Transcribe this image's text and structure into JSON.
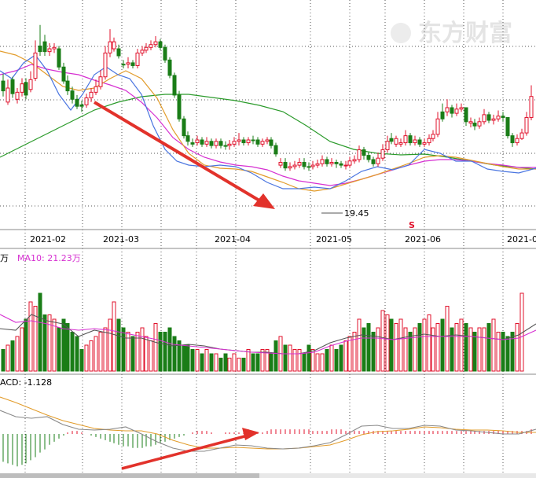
{
  "watermark": "东方财富",
  "price_panel": {
    "low_label": "19.45",
    "event_marker": "S",
    "ylim": [
      18.3,
      34.0
    ]
  },
  "x_axis": {
    "ticks": [
      "2021-02",
      "2021-03",
      "2021-04",
      "2021-05",
      "2021-06",
      "2021-0"
    ]
  },
  "volume_panel": {
    "legend_unit": "万",
    "legend_ma10": "MA10: 21.23万",
    "ylim": [
      0,
      24
    ]
  },
  "macd_panel": {
    "legend": "ACD: -1.128",
    "ylim": [
      -3.4,
      2.4
    ]
  },
  "colors": {
    "up": "#e0112b",
    "down": "#1a7d17",
    "ma5": "#4a75e0",
    "ma10": "#e29c2b",
    "ma20": "#d62fd1",
    "ma60": "#2a9a2a",
    "vol_ma5": "#555555",
    "vol_ma10": "#d62fd1",
    "dif": "#888888",
    "dea": "#e29c2b",
    "annotation_arrow": "#e2322b",
    "grid": "#555555"
  },
  "chart_data": {
    "type": "candlestick",
    "up": [
      0,
      1,
      0,
      1,
      1,
      0,
      1,
      1,
      0,
      0,
      1,
      1,
      0,
      0,
      0,
      0,
      0,
      0,
      1,
      1,
      1,
      1,
      1,
      1,
      1,
      0,
      0,
      1,
      0,
      1,
      1,
      1,
      1,
      1,
      0,
      0,
      0,
      0,
      0,
      0,
      0,
      0,
      1,
      0,
      1,
      0,
      1,
      0,
      0,
      1,
      1,
      1,
      0,
      1,
      0,
      0,
      1,
      1,
      0,
      0,
      1,
      0,
      1,
      1,
      1,
      0,
      0,
      1,
      1,
      1,
      0,
      1,
      0,
      0,
      1,
      1,
      1,
      1,
      0,
      0,
      0,
      1,
      1,
      1,
      0,
      1,
      1,
      1,
      0,
      1,
      0,
      1,
      1,
      1,
      1,
      0,
      1,
      0,
      1,
      1,
      0,
      1,
      0,
      1,
      1,
      0,
      1,
      1,
      0,
      0,
      0,
      1,
      1,
      1,
      1
    ],
    "close": [
      27.8,
      28.0,
      27.6,
      27.7,
      28.3,
      27.5,
      28.6,
      30.5,
      31.0,
      30.6,
      30.8,
      30.9,
      29.5,
      28.5,
      27.8,
      27.2,
      26.7,
      26.8,
      27.3,
      27.7,
      28.1,
      28.8,
      30.5,
      31.3,
      30.8,
      30.3,
      29.7,
      29.8,
      29.6,
      30.5,
      30.7,
      30.9,
      31.1,
      31.3,
      30.9,
      30.0,
      28.9,
      27.5,
      25.8,
      24.6,
      24.2,
      24.1,
      24.3,
      24.0,
      24.2,
      23.9,
      24.2,
      23.9,
      23.9,
      24.0,
      24.2,
      24.3,
      24.1,
      24.3,
      24.3,
      24.0,
      24.2,
      24.3,
      23.9,
      23.3,
      22.7,
      22.3,
      22.4,
      22.5,
      22.7,
      22.4,
      22.4,
      22.5,
      22.6,
      22.9,
      22.6,
      22.7,
      22.6,
      22.5,
      22.5,
      22.8,
      22.9,
      23.6,
      23.2,
      22.9,
      22.6,
      23.0,
      23.6,
      24.2,
      24.4,
      24.0,
      24.1,
      24.6,
      24.1,
      24.3,
      24.0,
      24.1,
      24.4,
      24.7,
      25.8,
      26.3,
      26.6,
      26.2,
      26.5,
      26.6,
      25.6,
      25.5,
      25.3,
      25.6,
      26.1,
      25.7,
      25.8,
      26.0,
      25.9,
      24.6,
      24.1,
      24.4,
      24.8,
      25.9,
      27.4
    ],
    "open": [
      28.5,
      27.0,
      28.6,
      27.2,
      27.7,
      28.4,
      27.9,
      28.7,
      30.6,
      31.3,
      30.6,
      30.8,
      30.8,
      29.5,
      28.5,
      27.8,
      27.2,
      26.7,
      26.8,
      27.3,
      27.7,
      28.1,
      28.8,
      30.5,
      31.3,
      30.8,
      29.7,
      29.7,
      29.8,
      29.6,
      30.5,
      30.7,
      30.9,
      31.1,
      31.3,
      30.9,
      30.0,
      28.9,
      27.5,
      25.8,
      24.6,
      24.0,
      24.1,
      24.3,
      24.0,
      24.2,
      23.9,
      24.2,
      23.9,
      23.9,
      24.0,
      24.2,
      24.3,
      24.1,
      24.3,
      24.3,
      24.0,
      24.2,
      24.3,
      23.9,
      22.5,
      22.7,
      22.3,
      22.4,
      22.5,
      22.7,
      22.4,
      22.4,
      22.5,
      22.6,
      22.9,
      22.6,
      22.7,
      22.6,
      22.5,
      22.5,
      22.8,
      22.9,
      23.6,
      23.2,
      22.9,
      22.6,
      23.0,
      23.6,
      24.2,
      24.4,
      24.0,
      24.1,
      24.6,
      24.1,
      24.3,
      24.0,
      24.1,
      24.4,
      24.7,
      25.8,
      26.3,
      26.6,
      26.2,
      26.5,
      26.6,
      25.6,
      25.5,
      25.3,
      25.6,
      26.1,
      25.7,
      25.8,
      26.0,
      25.9,
      24.6,
      24.1,
      24.4,
      24.8,
      25.9
    ],
    "high": [
      29.0,
      28.6,
      28.8,
      28.0,
      28.7,
      28.7,
      29.2,
      31.4,
      32.5,
      31.8,
      31.2,
      31.2,
      31.0,
      29.8,
      28.9,
      28.1,
      27.5,
      27.1,
      27.6,
      28.0,
      28.6,
      29.3,
      31.0,
      32.2,
      31.6,
      31.1,
      30.0,
      30.2,
      30.0,
      30.8,
      31.0,
      31.2,
      31.4,
      31.7,
      31.5,
      31.1,
      30.2,
      29.1,
      27.8,
      26.0,
      24.9,
      24.4,
      24.6,
      24.5,
      24.5,
      24.4,
      24.4,
      24.4,
      24.2,
      24.3,
      24.5,
      24.8,
      24.5,
      24.5,
      24.6,
      24.5,
      24.4,
      24.5,
      24.5,
      24.1,
      23.0,
      23.0,
      22.7,
      22.8,
      23.0,
      23.0,
      22.7,
      22.8,
      22.9,
      23.2,
      23.1,
      23.0,
      22.9,
      22.8,
      22.8,
      23.1,
      23.2,
      23.9,
      23.8,
      23.4,
      23.1,
      23.4,
      24.0,
      24.6,
      24.8,
      24.6,
      24.4,
      25.0,
      24.8,
      24.6,
      24.5,
      24.4,
      24.7,
      25.0,
      26.3,
      26.9,
      27.2,
      26.8,
      26.9,
      26.9,
      26.6,
      25.9,
      25.8,
      25.9,
      26.5,
      26.3,
      26.1,
      26.4,
      26.3,
      25.9,
      24.8,
      24.7,
      25.1,
      26.3,
      28.2
    ],
    "low": [
      27.4,
      26.8,
      27.3,
      26.9,
      27.4,
      27.2,
      27.7,
      28.5,
      30.3,
      30.3,
      30.3,
      30.5,
      29.3,
      28.3,
      27.5,
      26.9,
      26.5,
      26.3,
      26.6,
      27.0,
      27.5,
      27.9,
      28.6,
      30.2,
      30.6,
      30.1,
      29.4,
      29.4,
      29.4,
      29.4,
      30.3,
      30.5,
      30.7,
      30.9,
      30.7,
      29.8,
      28.7,
      27.3,
      25.6,
      24.4,
      23.9,
      23.8,
      23.9,
      23.8,
      23.8,
      23.7,
      23.7,
      23.7,
      23.6,
      23.6,
      23.8,
      23.9,
      23.9,
      23.9,
      24.0,
      23.8,
      23.8,
      24.0,
      23.7,
      23.1,
      22.3,
      22.1,
      22.1,
      22.2,
      22.3,
      22.2,
      22.1,
      22.2,
      22.3,
      22.4,
      22.4,
      22.4,
      22.3,
      22.3,
      22.2,
      22.3,
      22.6,
      22.7,
      22.9,
      22.7,
      22.4,
      22.4,
      22.8,
      23.4,
      24.0,
      23.8,
      23.8,
      23.9,
      23.9,
      23.9,
      23.8,
      23.8,
      23.9,
      24.2,
      24.5,
      25.6,
      26.0,
      25.9,
      26.0,
      26.3,
      25.3,
      25.2,
      25.0,
      25.1,
      25.4,
      25.5,
      25.4,
      25.6,
      25.6,
      24.4,
      23.8,
      23.9,
      24.3,
      24.6,
      25.7
    ],
    "volume": [
      5,
      6,
      7,
      8,
      10,
      12,
      16,
      15,
      18,
      13,
      13,
      12,
      10,
      12,
      11,
      9,
      8,
      5,
      6,
      7,
      8,
      9,
      10,
      12,
      16,
      12,
      10,
      9,
      8,
      9,
      10,
      8,
      7,
      11,
      9,
      9,
      10,
      8,
      7,
      6,
      6,
      5,
      5,
      4,
      5,
      4,
      4,
      3,
      4,
      3,
      4,
      3,
      3,
      5,
      4,
      4,
      5,
      5,
      4,
      7,
      8,
      6,
      6,
      5,
      5,
      4,
      6,
      5,
      4,
      4,
      5,
      6,
      5,
      6,
      7,
      8,
      9,
      12,
      10,
      11,
      9,
      10,
      14,
      13,
      12,
      11,
      12,
      10,
      9,
      10,
      11,
      12,
      13,
      10,
      11,
      12,
      15,
      10,
      11,
      12,
      11,
      10,
      9,
      10,
      10,
      11,
      12,
      9,
      9,
      8,
      9,
      11,
      18
    ],
    "macd": [
      -1.8,
      -1.9,
      -2.0,
      -2.1,
      -2.0,
      -1.9,
      -1.7,
      -1.5,
      -1.2,
      -1.0,
      -0.7,
      -0.5,
      -0.3,
      -0.1,
      0.1,
      0.2,
      0.2,
      0.1,
      0.0,
      -0.1,
      -0.2,
      -0.3,
      -0.4,
      -0.5,
      -0.6,
      -0.7,
      -0.8,
      -0.8,
      -0.9,
      -0.9,
      -0.9,
      -0.8,
      -0.8,
      -0.7,
      -0.6,
      -0.5,
      -0.4,
      -0.3,
      -0.2,
      -0.1,
      0.0,
      0.1,
      0.2,
      0.2,
      0.2,
      0.1,
      0.0,
      0.0,
      0.1,
      0.1,
      0.1,
      0.1,
      0.2,
      0.3,
      0.2,
      0.1,
      0.1,
      0.2,
      0.3,
      0.3,
      0.3,
      0.3,
      0.3,
      0.3,
      0.3,
      0.3,
      0.3,
      0.2,
      0.2,
      0.2,
      0.2,
      0.3,
      0.3,
      0.3,
      0.2,
      0.2,
      0.2,
      0.2,
      0.2,
      0.2,
      0.2,
      0.2,
      0.2,
      0.2,
      0.2,
      0.2,
      0.2,
      0.2,
      0.2,
      0.2,
      0.2,
      0.2,
      0.2,
      0.2,
      0.2,
      0.2,
      0.2,
      0.2,
      0.2,
      0.2,
      0.2,
      0.2,
      0.2,
      0.2,
      0.2,
      0.2,
      0.2,
      0.2,
      0.2,
      0.2,
      0.2,
      0.2,
      0.2,
      0.2,
      0.3
    ],
    "x_positions": [
      0,
      6,
      12,
      18,
      24,
      29,
      35,
      41,
      47,
      53,
      59,
      65,
      71,
      77,
      82,
      88,
      94,
      100,
      106,
      112,
      118,
      124,
      130,
      136,
      141,
      147,
      153,
      159,
      165,
      171,
      177,
      182,
      188,
      194,
      200,
      206,
      212,
      218,
      224,
      230,
      235,
      241,
      247,
      253,
      259,
      265,
      271,
      277,
      283,
      288,
      294,
      300,
      306,
      312,
      318,
      324,
      330,
      336,
      341,
      347,
      353,
      359,
      365,
      371,
      377,
      383,
      389,
      394,
      400,
      406,
      412,
      418,
      424,
      430,
      436,
      441,
      447,
      453,
      459,
      465,
      471,
      477,
      483,
      489,
      494,
      500,
      506,
      512,
      518,
      524,
      530,
      536,
      542,
      547,
      553,
      559,
      565,
      571,
      577,
      583,
      589,
      595,
      600,
      606,
      612,
      618,
      624,
      630,
      636,
      642,
      648,
      654,
      660,
      666,
      672,
      678
    ]
  }
}
